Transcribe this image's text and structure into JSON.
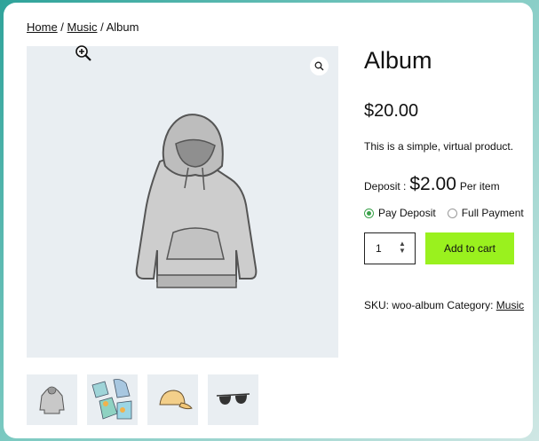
{
  "breadcrumb": {
    "home": "Home",
    "sep1": " / ",
    "music": "Music",
    "sep2": " / ",
    "current": "Album"
  },
  "product": {
    "title": "Album",
    "price": "$20.00",
    "description": "This is a simple, virtual product.",
    "deposit_label": "Deposit :",
    "deposit_amount": "$2.00",
    "deposit_unit": "Per item",
    "options": [
      {
        "label": "Pay Deposit",
        "checked": true
      },
      {
        "label": "Full Payment",
        "checked": false
      }
    ],
    "quantity": "1",
    "add_to_cart": "Add to cart",
    "sku_label": "SKU:",
    "sku": "woo-album",
    "category_label": "Category:",
    "category": "Music"
  },
  "gallery": {
    "thumbnails": [
      "hoodie",
      "hoodies-set",
      "cap",
      "sunglasses"
    ]
  },
  "colors": {
    "accent": "#9af11e",
    "radio": "#3aa14a"
  }
}
